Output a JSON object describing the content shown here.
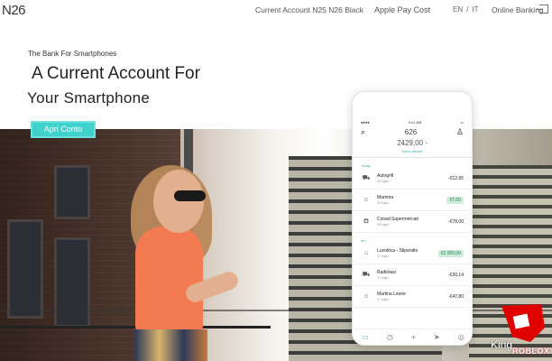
{
  "header": {
    "logo": "N26",
    "nav": [
      {
        "label": "Current Account N25 N26 Black"
      },
      {
        "label": "Apple Pay Cost"
      },
      {
        "label": "Online Banking"
      }
    ],
    "languages": [
      "EN",
      "/",
      "IT"
    ]
  },
  "hero": {
    "tagline": "The Bank For Smartphones",
    "title_line1": "A Current Account For",
    "title_line2": "Your Smartphone",
    "cta_label": "Apri Conto"
  },
  "phone": {
    "time": "9:41 AM",
    "account_id": "626",
    "balance": "2429,00 -",
    "balance_sub": "Saldo attuale",
    "sections": [
      {
        "label": "Today",
        "items": [
          {
            "icon": "car-icon",
            "glyph": "⛟",
            "name": "Autogrill",
            "sub": "28 luglio",
            "amount": "-€12,95",
            "positive": false
          },
          {
            "icon": "user-icon",
            "glyph": "☺",
            "name": "Mamma",
            "sub": "28 luglio",
            "amount": "€7,00",
            "positive": true
          },
          {
            "icon": "cart-icon",
            "glyph": "⛾",
            "name": "Conad Supermercati",
            "sub": "28 luglio",
            "amount": "-€78,00",
            "positive": false
          }
        ]
      },
      {
        "label": "Ieri",
        "items": [
          {
            "icon": "bank-icon",
            "glyph": "⌂",
            "name": "Luxottica - Stipendio",
            "sub": "27 luglio",
            "amount": "€2.000,00",
            "positive": true
          },
          {
            "icon": "car-icon",
            "glyph": "⛟",
            "name": "Radiotaxi",
            "sub": "27 luglio",
            "amount": "-€30,14",
            "positive": false
          },
          {
            "icon": "user-icon",
            "glyph": "☺",
            "name": "Martina Leone",
            "sub": "27 luglio",
            "amount": "-€47,80",
            "positive": false
          }
        ]
      }
    ],
    "nav": [
      "▭",
      "◷",
      "+",
      "➤",
      "◎"
    ]
  },
  "watermark": {
    "text": "King",
    "sub": "ROBLOX"
  }
}
